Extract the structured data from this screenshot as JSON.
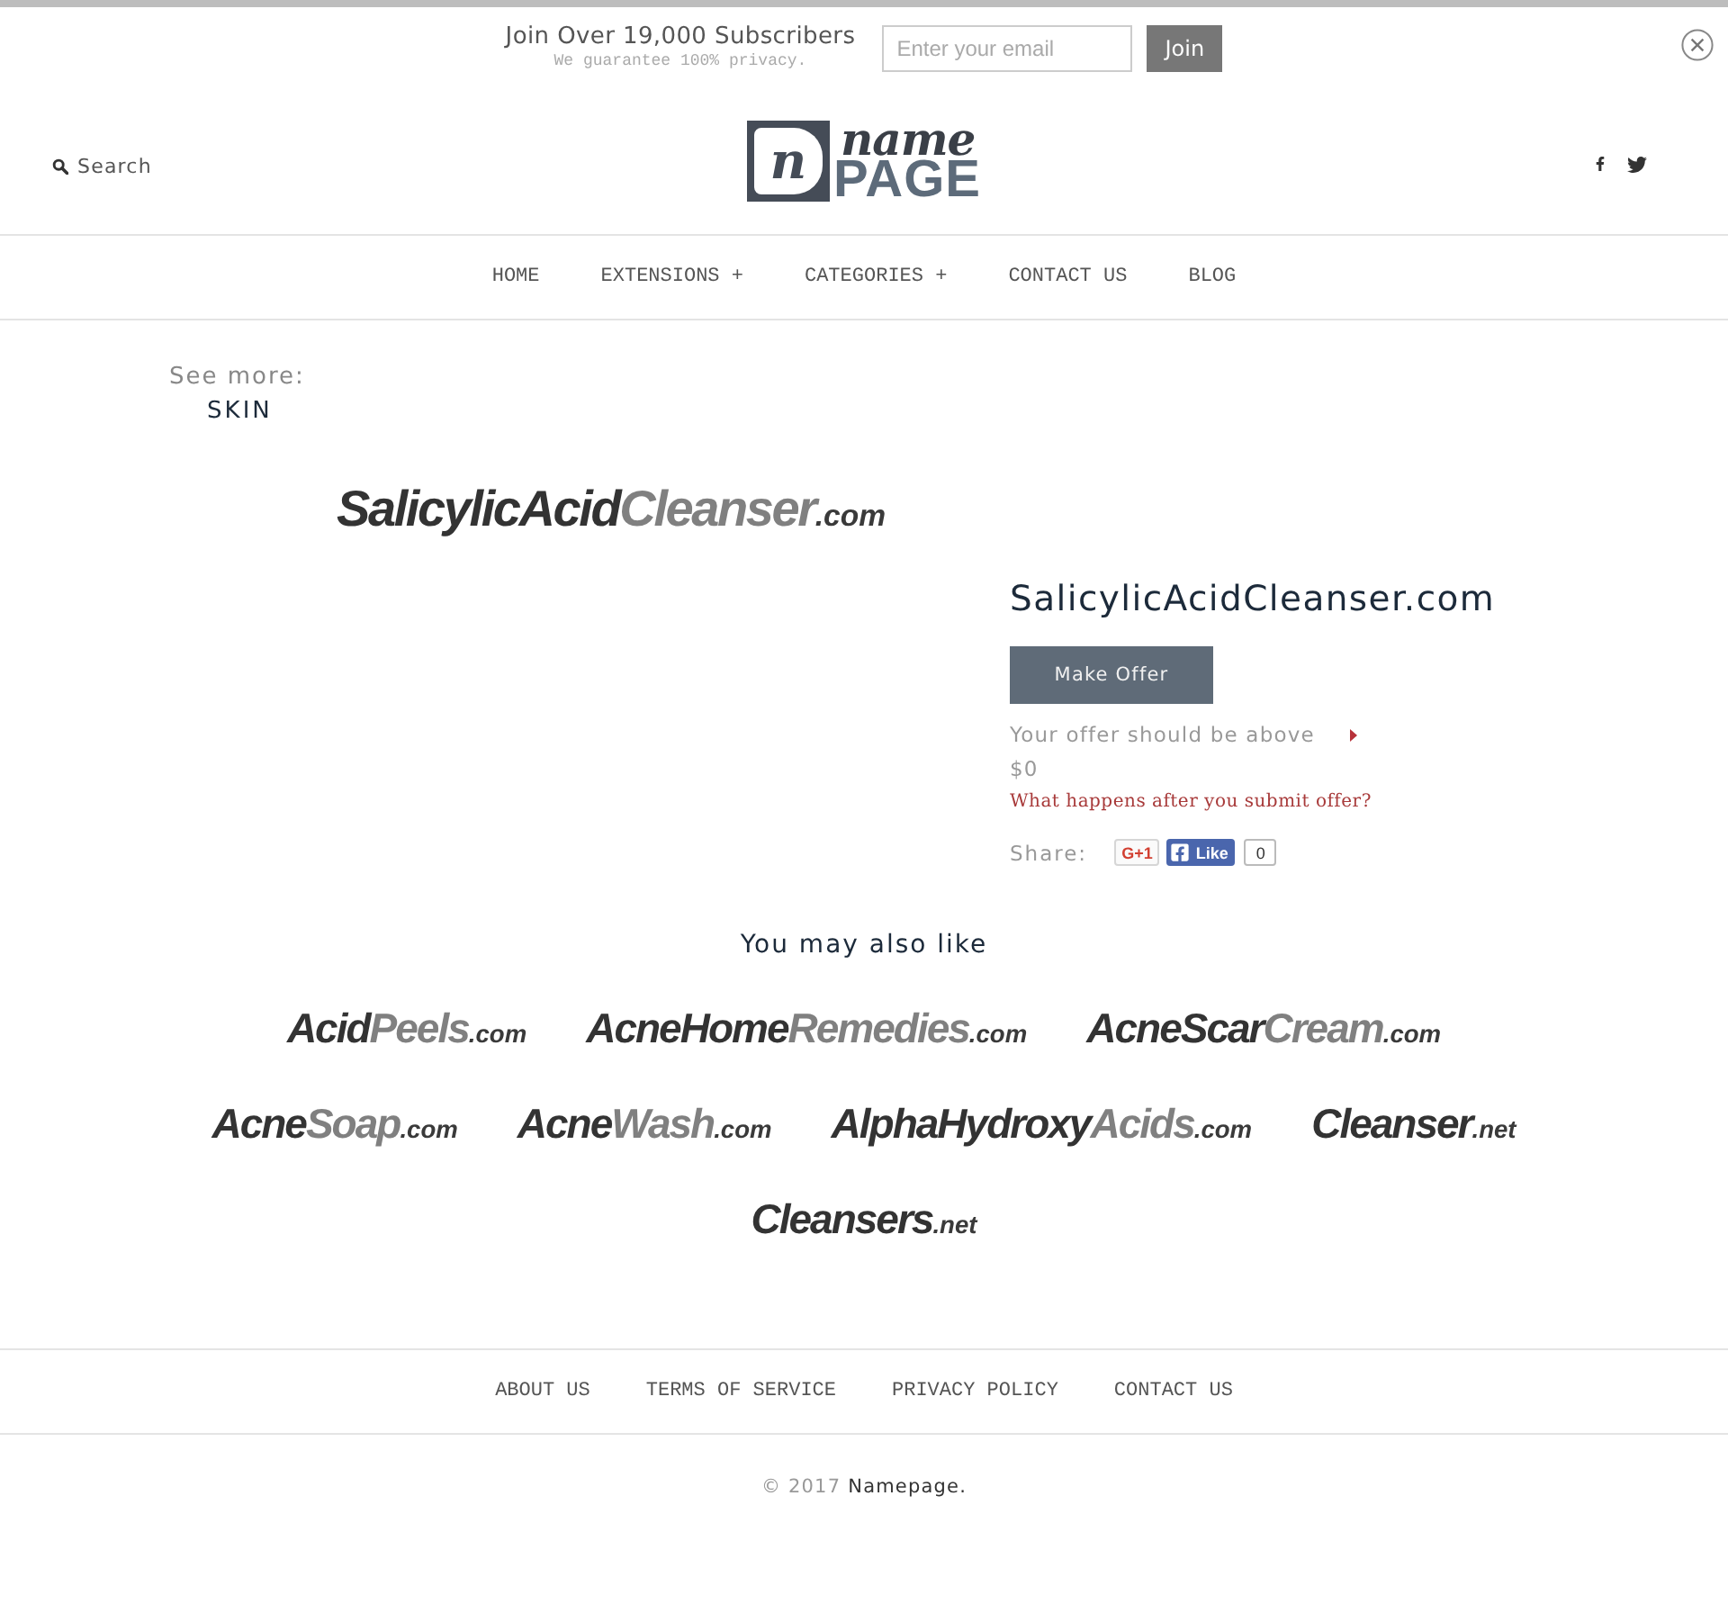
{
  "subscribe_bar": {
    "heading": "Join Over 19,000 Subscribers",
    "note": "We guarantee 100% privacy.",
    "email": {
      "placeholder": "Enter your email"
    },
    "button": "Join"
  },
  "header": {
    "search": {
      "label": "Search"
    },
    "logo": {
      "mark": "n",
      "top": "name",
      "bottom": "PAGE"
    }
  },
  "nav": [
    {
      "label": "HOME"
    },
    {
      "label": "EXTENSIONS",
      "toggle": "+"
    },
    {
      "label": "CATEGORIES",
      "toggle": "+"
    },
    {
      "label": "CONTACT US"
    },
    {
      "label": "BLOG"
    }
  ],
  "breadcrumb": {
    "label": "See more:",
    "category": "SKIN"
  },
  "product": {
    "logo": {
      "dark": "SalicylicAcid",
      "gray": "Cleanser",
      "tld": ".com"
    },
    "title": "SalicylicAcidCleanser.com",
    "button": "Make Offer",
    "offer_note": "Your offer should be above",
    "price": "$0",
    "help_link": "What happens after you submit offer?",
    "share": {
      "label": "Share:",
      "gplus": "G+1",
      "like": "Like",
      "like_count": "0"
    }
  },
  "related": {
    "heading": "You may also like",
    "rows": [
      {
        "items": [
          {
            "dark": "Acid",
            "gray": "Peels",
            "tld": ".com"
          },
          {
            "dark": "AcneHome",
            "gray": "Remedies",
            "tld": ".com"
          },
          {
            "dark": "AcneScar",
            "gray": "Cream",
            "tld": ".com"
          }
        ]
      },
      {
        "items": [
          {
            "dark": "Acne",
            "gray": "Soap",
            "tld": ".com"
          },
          {
            "dark": "Acne",
            "gray": "Wash",
            "tld": ".com"
          },
          {
            "dark": "AlphaHydroxy",
            "gray": "Acids",
            "tld": ".com"
          },
          {
            "dark": "Cleanser",
            "tld": ".net"
          }
        ]
      },
      {
        "items": [
          {
            "dark": "Cleansers",
            "tld": ".net"
          }
        ]
      }
    ]
  },
  "footer": {
    "links": [
      {
        "label": "ABOUT US"
      },
      {
        "label": "TERMS OF SERVICE"
      },
      {
        "label": "PRIVACY POLICY"
      },
      {
        "label": "CONTACT US"
      }
    ],
    "copyright": "© 2017",
    "brand": "Namepage."
  }
}
